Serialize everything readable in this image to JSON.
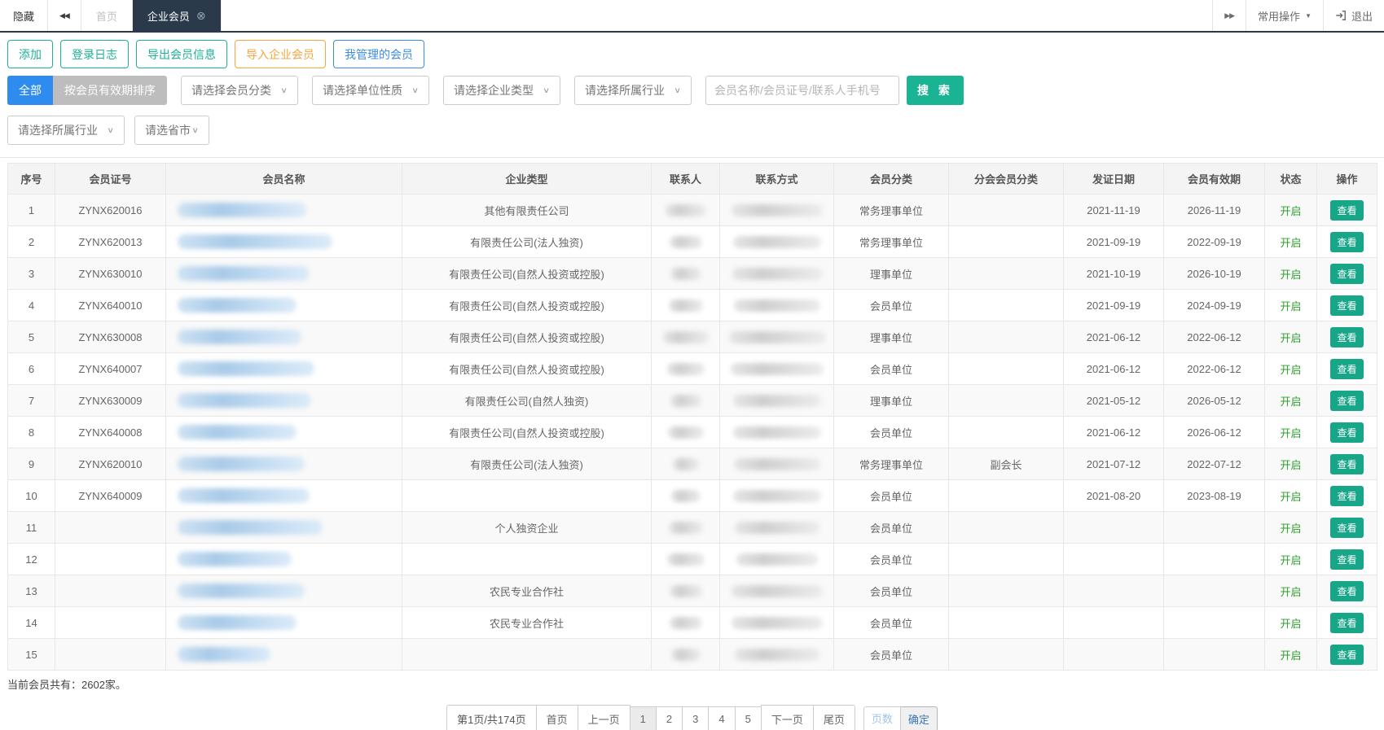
{
  "icons": {
    "double_left": "◀◀",
    "double_right": "▶▶",
    "caret_down": "▼",
    "chevron_down": "∨",
    "close_circle": "⊗"
  },
  "tabbar": {
    "hide_label": "隐藏",
    "tabs": [
      {
        "label": "首页",
        "active": false
      },
      {
        "label": "企业会员",
        "active": true
      }
    ],
    "common_ops_label": "常用操作",
    "logout_label": "退出"
  },
  "toolbar": {
    "buttons": [
      {
        "label": "添加",
        "color": "teal"
      },
      {
        "label": "登录日志",
        "color": "teal"
      },
      {
        "label": "导出会员信息",
        "color": "teal"
      },
      {
        "label": "导入企业会员",
        "color": "orange"
      },
      {
        "label": "我管理的会员",
        "color": "blue"
      }
    ]
  },
  "filters": {
    "all_label": "全部",
    "sort_label": "按会员有效期排序",
    "selects_row1": [
      "请选择会员分类",
      "请选择单位性质",
      "请选择企业类型",
      "请选择所属行业"
    ],
    "search_placeholder": "会员名称/会员证号/联系人手机号",
    "search_label": "搜 索",
    "selects_row2": [
      "请选择所属行业",
      "请选省市"
    ]
  },
  "table": {
    "headers": [
      "序号",
      "会员证号",
      "会员名称",
      "企业类型",
      "联系人",
      "联系方式",
      "会员分类",
      "分会会员分类",
      "发证日期",
      "会员有效期",
      "状态",
      "操作"
    ],
    "view_label": "查看",
    "rows": [
      {
        "no": "1",
        "cert": "ZYNX620016",
        "name_w": 158,
        "type": "其他有限责任公司",
        "contact_w": 50,
        "phone_w": 112,
        "category": "常务理事单位",
        "branch": "",
        "issued": "2021-11-19",
        "expires": "2026-11-19",
        "status": "开启"
      },
      {
        "no": "2",
        "cert": "ZYNX620013",
        "name_w": 190,
        "type": "有限责任公司(法人独资)",
        "contact_w": 40,
        "phone_w": 108,
        "category": "常务理事单位",
        "branch": "",
        "issued": "2021-09-19",
        "expires": "2022-09-19",
        "status": "开启"
      },
      {
        "no": "3",
        "cert": "ZYNX630010",
        "name_w": 162,
        "type": "有限责任公司(自然人投资或控股)",
        "contact_w": 38,
        "phone_w": 110,
        "category": "理事单位",
        "branch": "",
        "issued": "2021-10-19",
        "expires": "2026-10-19",
        "status": "开启"
      },
      {
        "no": "4",
        "cert": "ZYNX640010",
        "name_w": 146,
        "type": "有限责任公司(自然人投资或控股)",
        "contact_w": 42,
        "phone_w": 106,
        "category": "会员单位",
        "branch": "",
        "issued": "2021-09-19",
        "expires": "2024-09-19",
        "status": "开启"
      },
      {
        "no": "5",
        "cert": "ZYNX630008",
        "name_w": 152,
        "type": "有限责任公司(自然人投资或控股)",
        "contact_w": 56,
        "phone_w": 118,
        "category": "理事单位",
        "branch": "",
        "issued": "2021-06-12",
        "expires": "2022-06-12",
        "status": "开启"
      },
      {
        "no": "6",
        "cert": "ZYNX640007",
        "name_w": 168,
        "type": "有限责任公司(自然人投资或控股)",
        "contact_w": 46,
        "phone_w": 114,
        "category": "会员单位",
        "branch": "",
        "issued": "2021-06-12",
        "expires": "2022-06-12",
        "status": "开启"
      },
      {
        "no": "7",
        "cert": "ZYNX630009",
        "name_w": 164,
        "type": "有限责任公司(自然人独资)",
        "contact_w": 38,
        "phone_w": 108,
        "category": "理事单位",
        "branch": "",
        "issued": "2021-05-12",
        "expires": "2026-05-12",
        "status": "开启"
      },
      {
        "no": "8",
        "cert": "ZYNX640008",
        "name_w": 146,
        "type": "有限责任公司(自然人投资或控股)",
        "contact_w": 44,
        "phone_w": 108,
        "category": "会员单位",
        "branch": "",
        "issued": "2021-06-12",
        "expires": "2026-06-12",
        "status": "开启"
      },
      {
        "no": "9",
        "cert": "ZYNX620010",
        "name_w": 156,
        "type": "有限责任公司(法人独资)",
        "contact_w": 32,
        "phone_w": 106,
        "category": "常务理事单位",
        "branch": "副会长",
        "issued": "2021-07-12",
        "expires": "2022-07-12",
        "status": "开启"
      },
      {
        "no": "10",
        "cert": "ZYNX640009",
        "name_w": 162,
        "type": "",
        "contact_w": 36,
        "phone_w": 108,
        "category": "会员单位",
        "branch": "",
        "issued": "2021-08-20",
        "expires": "2023-08-19",
        "status": "开启"
      },
      {
        "no": "11",
        "cert": "",
        "name_w": 178,
        "type": "个人独资企业",
        "contact_w": 42,
        "phone_w": 104,
        "category": "会员单位",
        "branch": "",
        "issued": "",
        "expires": "",
        "status": "开启"
      },
      {
        "no": "12",
        "cert": "",
        "name_w": 140,
        "type": "",
        "contact_w": 46,
        "phone_w": 100,
        "category": "会员单位",
        "branch": "",
        "issued": "",
        "expires": "",
        "status": "开启"
      },
      {
        "no": "13",
        "cert": "",
        "name_w": 156,
        "type": "农民专业合作社",
        "contact_w": 40,
        "phone_w": 112,
        "category": "会员单位",
        "branch": "",
        "issued": "",
        "expires": "",
        "status": "开启"
      },
      {
        "no": "14",
        "cert": "",
        "name_w": 146,
        "type": "农民专业合作社",
        "contact_w": 40,
        "phone_w": 112,
        "category": "会员单位",
        "branch": "",
        "issued": "",
        "expires": "",
        "status": "开启"
      },
      {
        "no": "15",
        "cert": "",
        "name_w": 114,
        "type": "",
        "contact_w": 36,
        "phone_w": 104,
        "category": "会员单位",
        "branch": "",
        "issued": "",
        "expires": "",
        "status": "开启"
      }
    ]
  },
  "footer": {
    "summary": "当前会员共有：2602家。"
  },
  "pagination": {
    "info": "第1页/共174页",
    "first": "首页",
    "prev": "上一页",
    "pages": [
      "1",
      "2",
      "3",
      "4",
      "5"
    ],
    "current": "1",
    "next": "下一页",
    "last": "尾页",
    "page_input_placeholder": "页数",
    "confirm": "确定"
  }
}
